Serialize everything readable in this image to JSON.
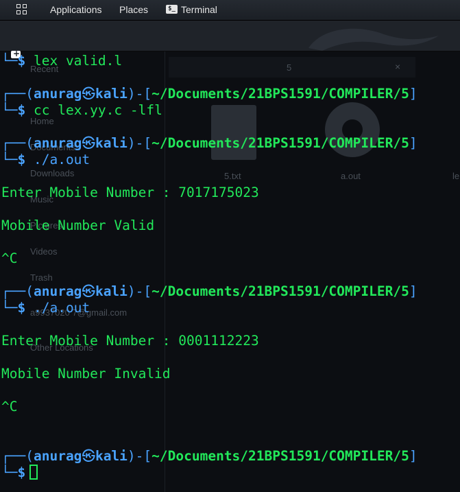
{
  "topbar": {
    "applications": "Applications",
    "places": "Places",
    "terminal": "Terminal",
    "terminal_icon_glyph": "$_"
  },
  "background": {
    "sidebar": [
      "Recent",
      "Home",
      "Documents",
      "Downloads",
      "Music",
      "Pictures",
      "Videos",
      "Trash",
      "a9937020 7@gmail.com",
      "Other Locations"
    ],
    "tab_title": "5",
    "close": "×",
    "files": [
      "5.txt",
      "a.out",
      "le"
    ]
  },
  "terminal": {
    "prompt_corner_top": "┌──",
    "prompt_corner_bottom": "└─",
    "user": "anurag",
    "at_symbol": "㉿",
    "host": "kali",
    "path": "~/Documents/21BPS1591/COMPILER/5",
    "dollar": "$",
    "cmd1": "lex valid.l",
    "cmd2_program": "cc",
    "cmd2_args": "lex.yy.c -lfl",
    "cmd3": "./a.out",
    "out1": "Enter Mobile Number : 7017175023",
    "out2": "Mobile Number Valid",
    "interrupt": "^C",
    "cmd4": "./a.out",
    "out3": "Enter Mobile Number : 0001112223",
    "out4": "Mobile Number Invalid"
  },
  "colors": {
    "prompt_blue": "#4aa3ff",
    "text_green": "#22e85a",
    "background": "#0c0e12"
  }
}
